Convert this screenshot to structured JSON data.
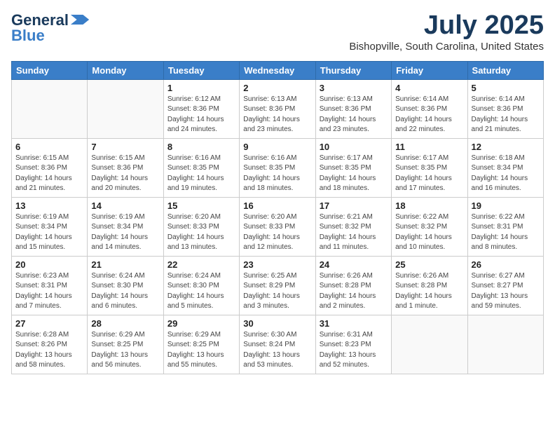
{
  "header": {
    "logo_general": "General",
    "logo_blue": "Blue",
    "month": "July 2025",
    "location": "Bishopville, South Carolina, United States"
  },
  "weekdays": [
    "Sunday",
    "Monday",
    "Tuesday",
    "Wednesday",
    "Thursday",
    "Friday",
    "Saturday"
  ],
  "weeks": [
    [
      {
        "day": "",
        "info": ""
      },
      {
        "day": "",
        "info": ""
      },
      {
        "day": "1",
        "info": "Sunrise: 6:12 AM\nSunset: 8:36 PM\nDaylight: 14 hours and 24 minutes."
      },
      {
        "day": "2",
        "info": "Sunrise: 6:13 AM\nSunset: 8:36 PM\nDaylight: 14 hours and 23 minutes."
      },
      {
        "day": "3",
        "info": "Sunrise: 6:13 AM\nSunset: 8:36 PM\nDaylight: 14 hours and 23 minutes."
      },
      {
        "day": "4",
        "info": "Sunrise: 6:14 AM\nSunset: 8:36 PM\nDaylight: 14 hours and 22 minutes."
      },
      {
        "day": "5",
        "info": "Sunrise: 6:14 AM\nSunset: 8:36 PM\nDaylight: 14 hours and 21 minutes."
      }
    ],
    [
      {
        "day": "6",
        "info": "Sunrise: 6:15 AM\nSunset: 8:36 PM\nDaylight: 14 hours and 21 minutes."
      },
      {
        "day": "7",
        "info": "Sunrise: 6:15 AM\nSunset: 8:36 PM\nDaylight: 14 hours and 20 minutes."
      },
      {
        "day": "8",
        "info": "Sunrise: 6:16 AM\nSunset: 8:35 PM\nDaylight: 14 hours and 19 minutes."
      },
      {
        "day": "9",
        "info": "Sunrise: 6:16 AM\nSunset: 8:35 PM\nDaylight: 14 hours and 18 minutes."
      },
      {
        "day": "10",
        "info": "Sunrise: 6:17 AM\nSunset: 8:35 PM\nDaylight: 14 hours and 18 minutes."
      },
      {
        "day": "11",
        "info": "Sunrise: 6:17 AM\nSunset: 8:35 PM\nDaylight: 14 hours and 17 minutes."
      },
      {
        "day": "12",
        "info": "Sunrise: 6:18 AM\nSunset: 8:34 PM\nDaylight: 14 hours and 16 minutes."
      }
    ],
    [
      {
        "day": "13",
        "info": "Sunrise: 6:19 AM\nSunset: 8:34 PM\nDaylight: 14 hours and 15 minutes."
      },
      {
        "day": "14",
        "info": "Sunrise: 6:19 AM\nSunset: 8:34 PM\nDaylight: 14 hours and 14 minutes."
      },
      {
        "day": "15",
        "info": "Sunrise: 6:20 AM\nSunset: 8:33 PM\nDaylight: 14 hours and 13 minutes."
      },
      {
        "day": "16",
        "info": "Sunrise: 6:20 AM\nSunset: 8:33 PM\nDaylight: 14 hours and 12 minutes."
      },
      {
        "day": "17",
        "info": "Sunrise: 6:21 AM\nSunset: 8:32 PM\nDaylight: 14 hours and 11 minutes."
      },
      {
        "day": "18",
        "info": "Sunrise: 6:22 AM\nSunset: 8:32 PM\nDaylight: 14 hours and 10 minutes."
      },
      {
        "day": "19",
        "info": "Sunrise: 6:22 AM\nSunset: 8:31 PM\nDaylight: 14 hours and 8 minutes."
      }
    ],
    [
      {
        "day": "20",
        "info": "Sunrise: 6:23 AM\nSunset: 8:31 PM\nDaylight: 14 hours and 7 minutes."
      },
      {
        "day": "21",
        "info": "Sunrise: 6:24 AM\nSunset: 8:30 PM\nDaylight: 14 hours and 6 minutes."
      },
      {
        "day": "22",
        "info": "Sunrise: 6:24 AM\nSunset: 8:30 PM\nDaylight: 14 hours and 5 minutes."
      },
      {
        "day": "23",
        "info": "Sunrise: 6:25 AM\nSunset: 8:29 PM\nDaylight: 14 hours and 3 minutes."
      },
      {
        "day": "24",
        "info": "Sunrise: 6:26 AM\nSunset: 8:28 PM\nDaylight: 14 hours and 2 minutes."
      },
      {
        "day": "25",
        "info": "Sunrise: 6:26 AM\nSunset: 8:28 PM\nDaylight: 14 hours and 1 minute."
      },
      {
        "day": "26",
        "info": "Sunrise: 6:27 AM\nSunset: 8:27 PM\nDaylight: 13 hours and 59 minutes."
      }
    ],
    [
      {
        "day": "27",
        "info": "Sunrise: 6:28 AM\nSunset: 8:26 PM\nDaylight: 13 hours and 58 minutes."
      },
      {
        "day": "28",
        "info": "Sunrise: 6:29 AM\nSunset: 8:25 PM\nDaylight: 13 hours and 56 minutes."
      },
      {
        "day": "29",
        "info": "Sunrise: 6:29 AM\nSunset: 8:25 PM\nDaylight: 13 hours and 55 minutes."
      },
      {
        "day": "30",
        "info": "Sunrise: 6:30 AM\nSunset: 8:24 PM\nDaylight: 13 hours and 53 minutes."
      },
      {
        "day": "31",
        "info": "Sunrise: 6:31 AM\nSunset: 8:23 PM\nDaylight: 13 hours and 52 minutes."
      },
      {
        "day": "",
        "info": ""
      },
      {
        "day": "",
        "info": ""
      }
    ]
  ]
}
